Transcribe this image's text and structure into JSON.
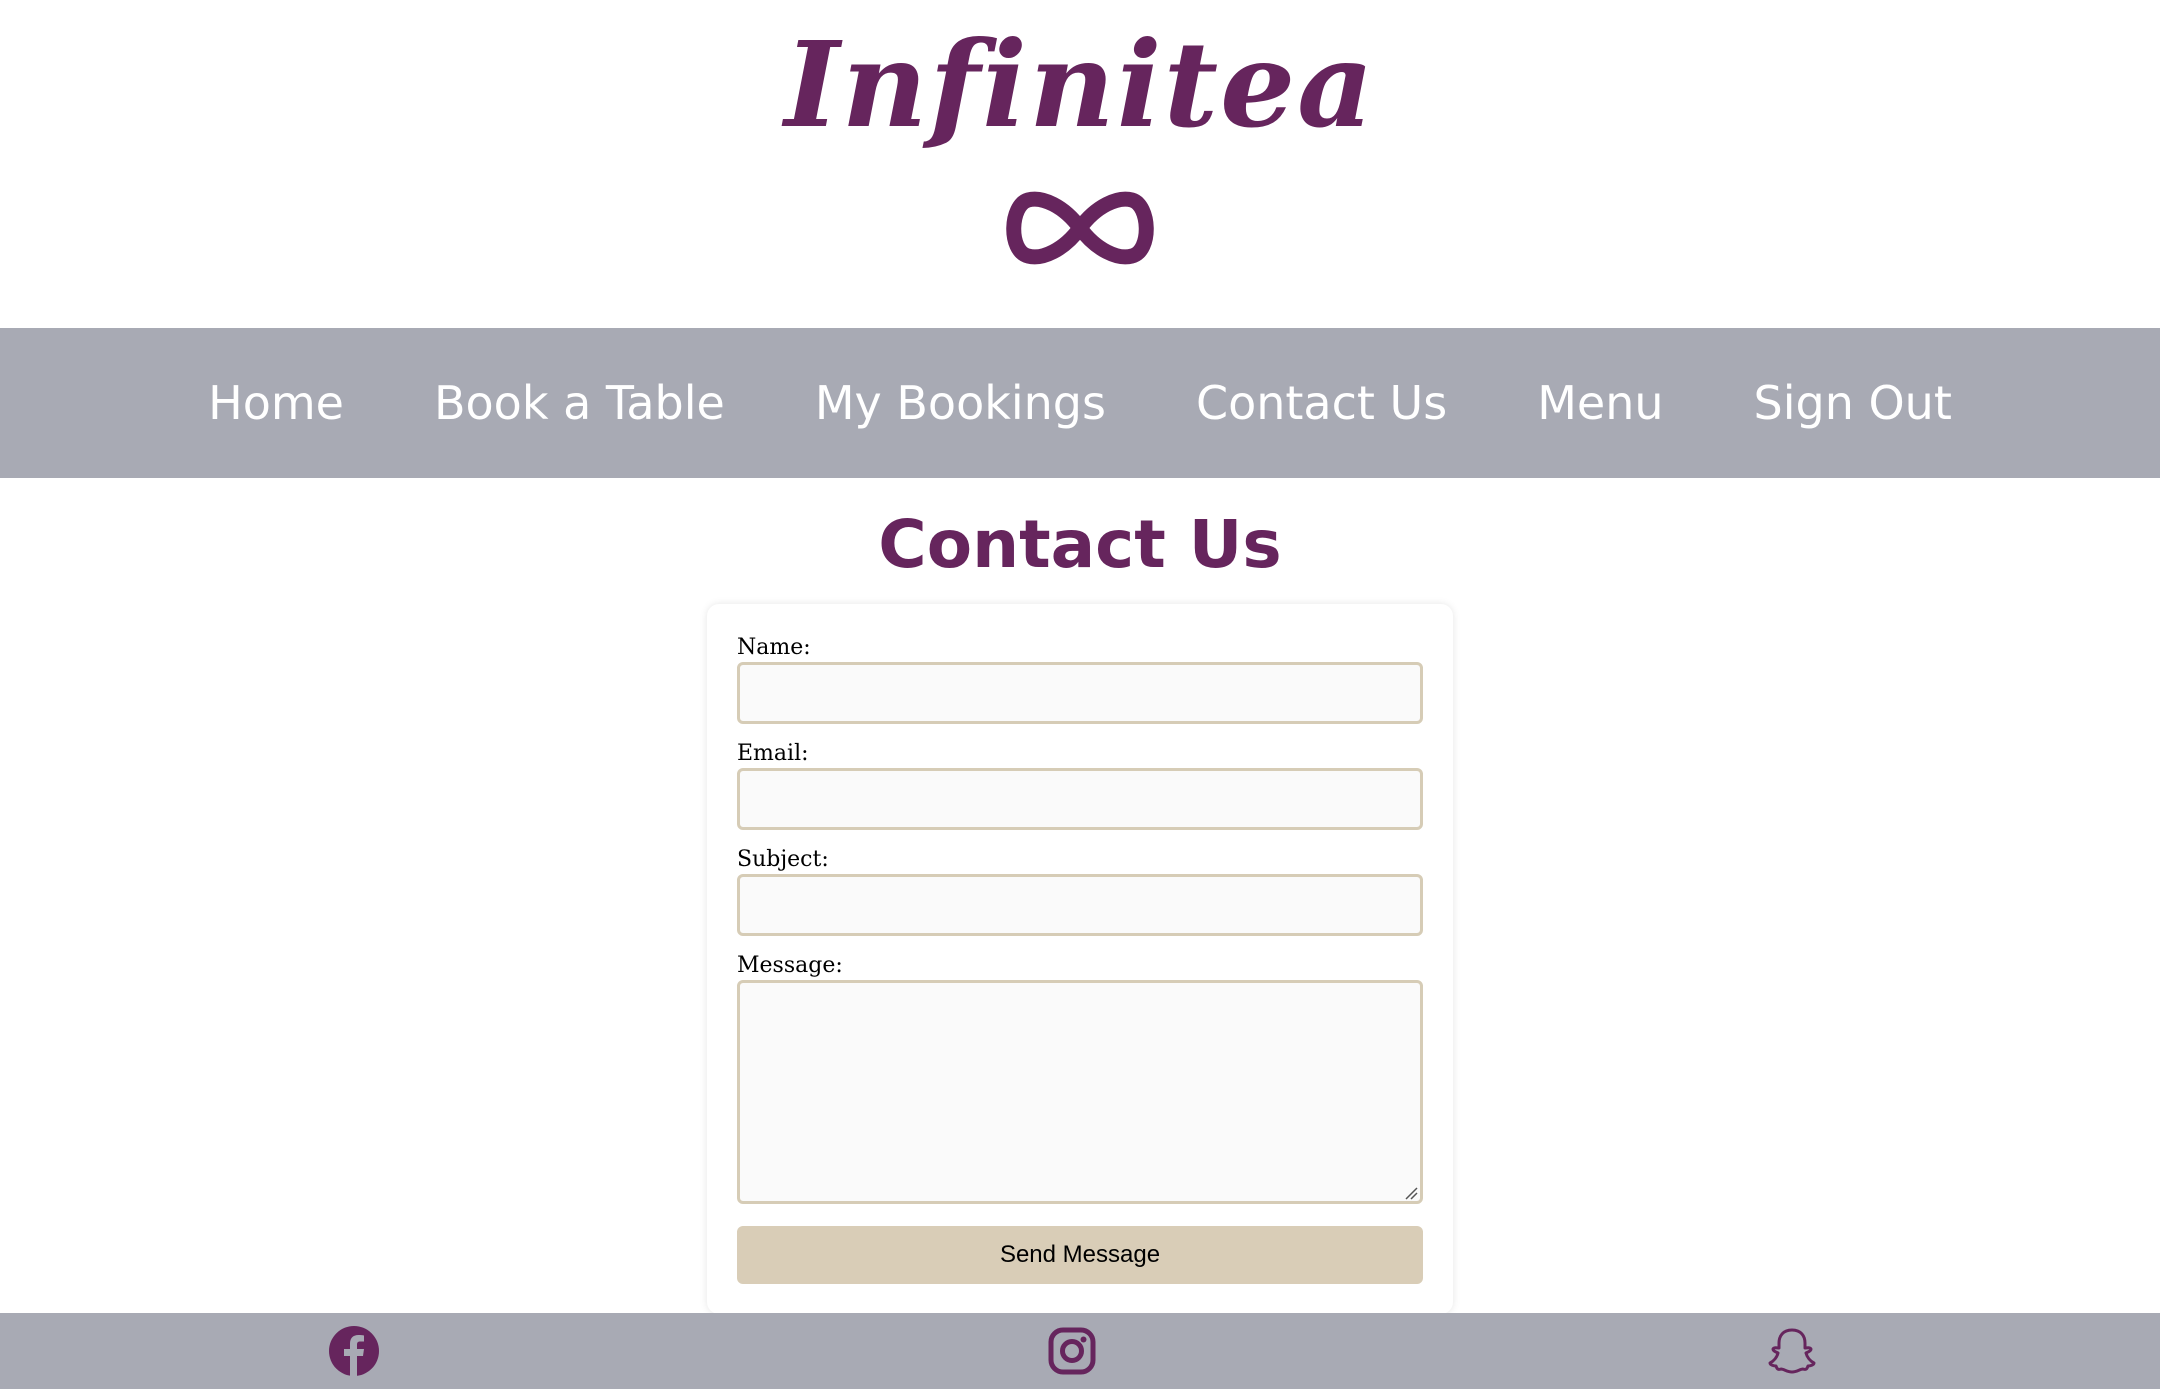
{
  "brand": {
    "name": "Infinitea",
    "mark_icon": "infinity-icon",
    "color": "#66255d"
  },
  "nav": {
    "items": [
      {
        "label": "Home"
      },
      {
        "label": "Book a Table"
      },
      {
        "label": "My Bookings"
      },
      {
        "label": "Contact Us"
      },
      {
        "label": "Menu"
      },
      {
        "label": "Sign Out"
      }
    ],
    "background": "#a8aab4"
  },
  "page": {
    "title": "Contact Us"
  },
  "form": {
    "name_label": "Name:",
    "name_value": "",
    "email_label": "Email:",
    "email_value": "",
    "subject_label": "Subject:",
    "subject_value": "",
    "message_label": "Message:",
    "message_value": "",
    "submit_label": "Send Message",
    "button_color": "#d9cdb7",
    "border_color": "#d6ccb6"
  },
  "footer": {
    "icons": [
      "facebook-icon",
      "instagram-icon",
      "snapchat-icon"
    ]
  }
}
